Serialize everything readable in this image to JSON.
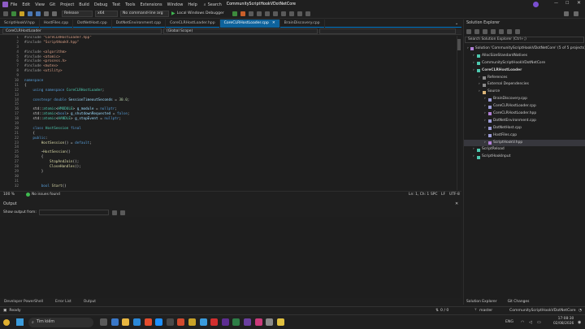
{
  "menu": [
    "File",
    "Edit",
    "View",
    "Git",
    "Project",
    "Build",
    "Debug",
    "Test",
    "Tools",
    "Extensions",
    "Window",
    "Help"
  ],
  "search_label": "Search",
  "window_title": "CommunityScriptHookVDotNetCore",
  "toolbar": {
    "config": "Release",
    "platform": "x64",
    "cmdline": "No command-line arg",
    "run_label": "Local Windows Debugger"
  },
  "tabs": [
    "ScriptHookV.hpp",
    "HostFiles.cpp",
    "DotNetHost.cpp",
    "DotNetEnvironment.cpp",
    "CoreCLRHostLoader.hpp",
    "CoreCLRHostLoader.cpp",
    "BrainDiscovery.cpp"
  ],
  "active_tab": 5,
  "nav": {
    "project": "CoreCLRHostLoader",
    "scope": "(Global Scope)"
  },
  "code_lines": [
    [
      [
        "pp",
        "#include "
      ],
      [
        "str",
        "\"CoreCLRHostLoader.hpp\""
      ]
    ],
    [
      [
        "pp",
        "#include "
      ],
      [
        "str",
        "\"ScriptHookV.hpp\""
      ]
    ],
    [],
    [
      [
        "pp",
        "#include "
      ],
      [
        "str",
        "<algorithm>"
      ]
    ],
    [
      [
        "pp",
        "#include "
      ],
      [
        "str",
        "<atomic>"
      ]
    ],
    [
      [
        "pp",
        "#include "
      ],
      [
        "str",
        "<process.h>"
      ]
    ],
    [
      [
        "pp",
        "#include "
      ],
      [
        "str",
        "<mutex>"
      ]
    ],
    [
      [
        "pp",
        "#include "
      ],
      [
        "str",
        "<utility>"
      ]
    ],
    [],
    [
      [
        "kw",
        "namespace"
      ]
    ],
    [
      [
        "tx",
        "{"
      ]
    ],
    [
      [
        "tx",
        "    "
      ],
      [
        "kw",
        "using namespace "
      ],
      [
        "ty",
        "CoreCLRHostLoader"
      ],
      [
        "tx",
        ";"
      ]
    ],
    [],
    [
      [
        "tx",
        "    "
      ],
      [
        "kw",
        "constexpr double "
      ],
      [
        "va",
        "SessionTimeoutSeconds"
      ],
      [
        "tx",
        " = "
      ],
      [
        "nm",
        "30.0"
      ],
      [
        "tx",
        ";"
      ]
    ],
    [],
    [
      [
        "tx",
        "    std::"
      ],
      [
        "ty",
        "atomic"
      ],
      [
        "tx",
        "<"
      ],
      [
        "ty",
        "HMODULE"
      ],
      [
        "tx",
        "> "
      ],
      [
        "va",
        "g_module"
      ],
      [
        "tx",
        " = "
      ],
      [
        "kw",
        "nullptr"
      ],
      [
        "tx",
        ";"
      ]
    ],
    [
      [
        "tx",
        "    std::"
      ],
      [
        "ty",
        "atomic"
      ],
      [
        "tx",
        "<"
      ],
      [
        "kw",
        "bool"
      ],
      [
        "tx",
        "> "
      ],
      [
        "va",
        "g_shutdownRequested"
      ],
      [
        "tx",
        " = "
      ],
      [
        "kw",
        "false"
      ],
      [
        "tx",
        ";"
      ]
    ],
    [
      [
        "tx",
        "    std::"
      ],
      [
        "ty",
        "atomic"
      ],
      [
        "tx",
        "<"
      ],
      [
        "ty",
        "HANDLE"
      ],
      [
        "tx",
        "> "
      ],
      [
        "va",
        "g_stopEvent"
      ],
      [
        "tx",
        " = "
      ],
      [
        "kw",
        "nullptr"
      ],
      [
        "tx",
        ";"
      ]
    ],
    [],
    [
      [
        "tx",
        "    "
      ],
      [
        "kw",
        "class "
      ],
      [
        "ty",
        "HostSession "
      ],
      [
        "kw",
        "final"
      ]
    ],
    [
      [
        "tx",
        "    {"
      ]
    ],
    [
      [
        "tx",
        "    "
      ],
      [
        "kw",
        "public"
      ],
      [
        "tx",
        ":"
      ]
    ],
    [
      [
        "tx",
        "        "
      ],
      [
        "fn",
        "HostSession"
      ],
      [
        "tx",
        "() = "
      ],
      [
        "kw",
        "default"
      ],
      [
        "tx",
        ";"
      ]
    ],
    [],
    [
      [
        "tx",
        "        ~"
      ],
      [
        "fn",
        "HostSession"
      ],
      [
        "tx",
        "()"
      ]
    ],
    [
      [
        "tx",
        "        {"
      ]
    ],
    [
      [
        "tx",
        "            "
      ],
      [
        "fn",
        "StopAndJoin"
      ],
      [
        "tx",
        "();"
      ]
    ],
    [
      [
        "tx",
        "            "
      ],
      [
        "fn",
        "CloseHandles"
      ],
      [
        "tx",
        "();"
      ]
    ],
    [
      [
        "tx",
        "        }"
      ]
    ],
    [],
    [],
    [
      [
        "tx",
        "        "
      ],
      [
        "kw",
        "bool "
      ],
      [
        "fn",
        "Start"
      ],
      [
        "tx",
        "()"
      ]
    ]
  ],
  "editor_status": {
    "zoom": "100 %",
    "issues": "No issues found",
    "position": "Ln: 1, Ch: 1",
    "spc": "SPC",
    "lf": "LF",
    "encoding": "UTF-8"
  },
  "output": {
    "title": "Output",
    "show_from": "Show output from:"
  },
  "bottom_tabs": [
    "Developer PowerShell",
    "Error List",
    "Output"
  ],
  "solution_explorer": {
    "title": "Solution Explorer",
    "search_placeholder": "Search Solution Explorer (Ctrl+;)",
    "items": [
      {
        "label": "Solution 'CommunityScriptHookVDotNetCore' (5 of 5 projects)",
        "indent": 0,
        "icon": "solution-icon",
        "color": "#b180d7"
      },
      {
        "label": "AllocSizeStandardNatives",
        "indent": 1,
        "icon": "project-icon",
        "color": "#4ec9b0"
      },
      {
        "label": "CommunityScriptHookVDotNetCore",
        "indent": 1,
        "icon": "project-icon",
        "color": "#4ec9b0"
      },
      {
        "label": "CoreCLRHostLoader",
        "indent": 1,
        "icon": "project-icon",
        "color": "#4ec9b0",
        "bold": true
      },
      {
        "label": "References",
        "indent": 2,
        "icon": "references-icon",
        "color": "#8a8a8a"
      },
      {
        "label": "External Dependencies",
        "indent": 2,
        "icon": "dependencies-icon",
        "color": "#8a8a8a"
      },
      {
        "label": "Source",
        "indent": 2,
        "icon": "folder-icon",
        "color": "#dcb67a"
      },
      {
        "label": "BrainDiscovery.cpp",
        "indent": 3,
        "icon": "cpp-file-icon",
        "color": "#9b9bd6"
      },
      {
        "label": "CoreCLRHostLoader.cpp",
        "indent": 3,
        "icon": "cpp-file-icon",
        "color": "#9b9bd6"
      },
      {
        "label": "CoreCLRHostLoader.hpp",
        "indent": 3,
        "icon": "header-file-icon",
        "color": "#b180d7"
      },
      {
        "label": "DotNetEnvironment.cpp",
        "indent": 3,
        "icon": "cpp-file-icon",
        "color": "#9b9bd6"
      },
      {
        "label": "DotNetHost.cpp",
        "indent": 3,
        "icon": "cpp-file-icon",
        "color": "#9b9bd6"
      },
      {
        "label": "HostFiles.cpp",
        "indent": 3,
        "icon": "cpp-file-icon",
        "color": "#9b9bd6"
      },
      {
        "label": "ScriptHookV.hpp",
        "indent": 3,
        "icon": "header-file-icon",
        "color": "#b180d7",
        "selected": true
      },
      {
        "label": "ScriptReload",
        "indent": 1,
        "icon": "project-icon",
        "color": "#4ec9b0"
      },
      {
        "label": "ScriptHookInput",
        "indent": 1,
        "icon": "project-icon",
        "color": "#4ec9b0"
      }
    ],
    "bottom_tabs": [
      "Solution Explorer",
      "Git Changes"
    ]
  },
  "statusbar": {
    "ready": "Ready",
    "git_counts": "0 / 0",
    "branch": "master",
    "repo": "CommunityScriptHookVDotNetCore"
  },
  "taskbar": {
    "search_placeholder": "Tìm kiếm",
    "lang": "ENG",
    "time": "17:08:30",
    "date": "02/08/2026"
  }
}
